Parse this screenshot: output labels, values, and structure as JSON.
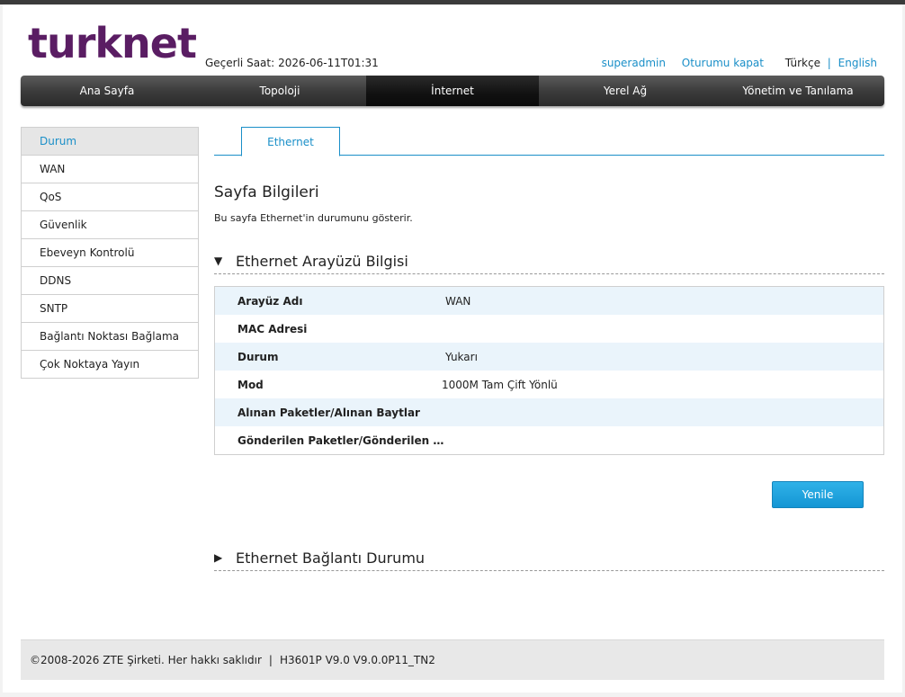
{
  "brand": {
    "logo_text": "turknet",
    "logo_color": "#5a1d63",
    "accent": "#1a8fc8"
  },
  "header": {
    "clock_label": "Geçerli Saat:",
    "clock_value": "2026-06-11T01:31",
    "user": "superadmin",
    "logout": "Oturumu kapat",
    "lang_current": "Türkçe",
    "lang_sep": "|",
    "lang_other": "English"
  },
  "nav": {
    "items": [
      "Ana Sayfa",
      "Topoloji",
      "İnternet",
      "Yerel Ağ",
      "Yönetim ve Tanılama"
    ],
    "active": "İnternet"
  },
  "sidebar": {
    "items": [
      "Durum",
      "WAN",
      "QoS",
      "Güvenlik",
      "Ebeveyn Kontrolü",
      "DDNS",
      "SNTP",
      "Bağlantı Noktası Bağlama",
      "Çok Noktaya Yayın"
    ],
    "active": "Durum"
  },
  "tabs": {
    "active": "Ethernet"
  },
  "page": {
    "title": "Sayfa Bilgileri",
    "description": "Bu sayfa Ethernet'in durumunu gösterir."
  },
  "section1": {
    "arrow": "▼",
    "title": "Ethernet Arayüzü Bilgisi",
    "rows": [
      {
        "key": "Arayüz Adı",
        "value": "WAN"
      },
      {
        "key": "MAC Adresi",
        "value": ""
      },
      {
        "key": "Durum",
        "value": "Yukarı"
      },
      {
        "key": "Mod",
        "value": "1000M Tam Çift Yönlü"
      },
      {
        "key": "Alınan Paketler/Alınan Baytlar",
        "value": ""
      },
      {
        "key": "Gönderilen Paketler/Gönderilen Bayt S...",
        "value": ""
      }
    ]
  },
  "refresh_button": "Yenile",
  "section2": {
    "arrow": "▶",
    "title": "Ethernet Bağlantı Durumu"
  },
  "footer": {
    "copyright": "©2008-2026 ZTE Şirketi. Her hakkı saklıdır",
    "sep": "|",
    "version": "H3601P V9.0 V9.0.0P11_TN2"
  }
}
